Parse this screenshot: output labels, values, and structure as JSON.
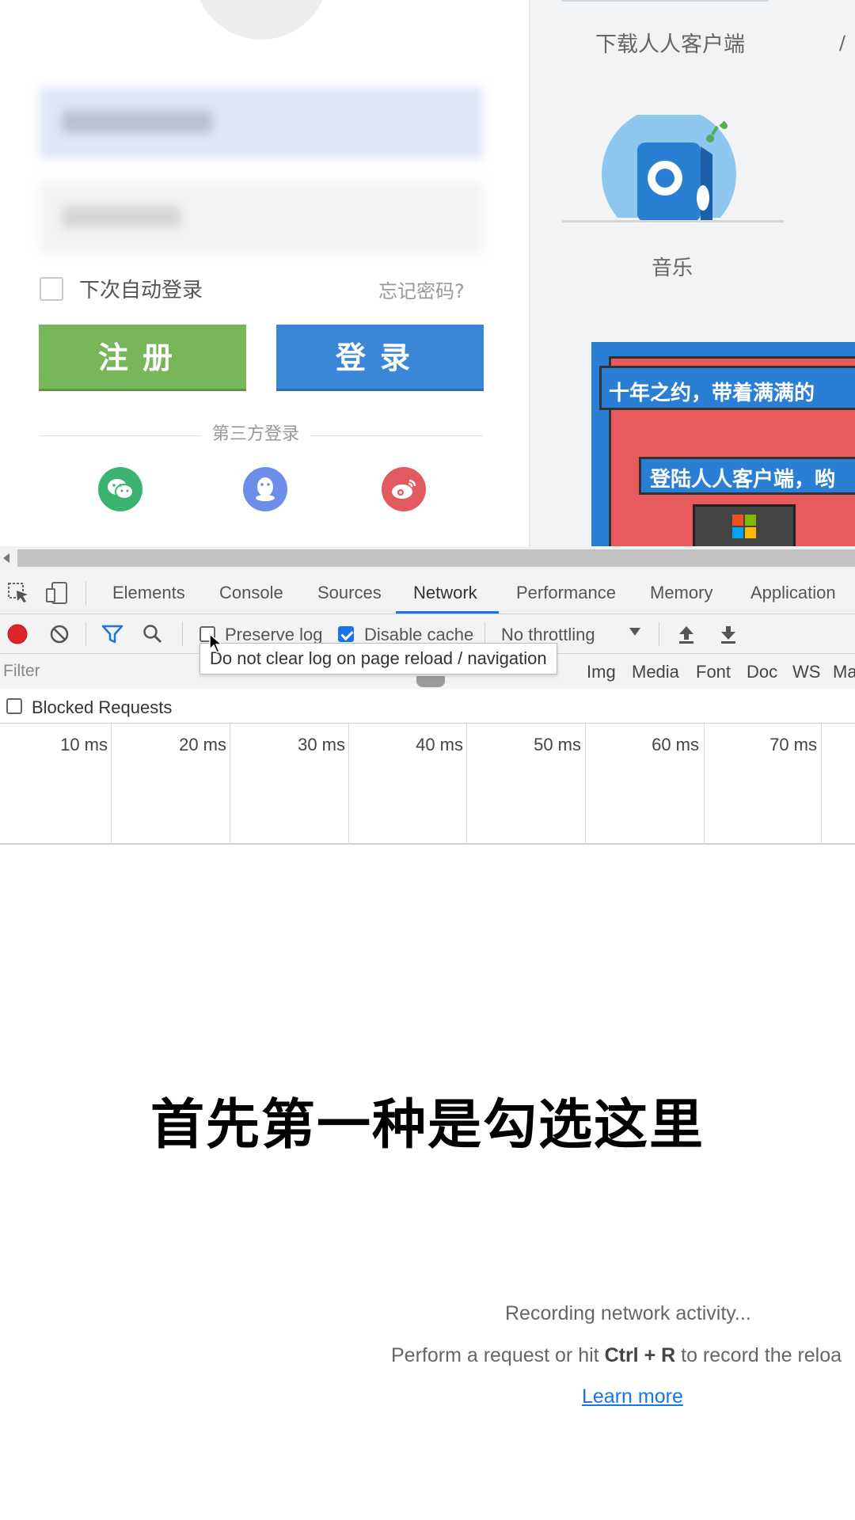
{
  "login": {
    "remember_label": "下次自动登录",
    "forgot_label": "忘记密码?",
    "register_label": "注册",
    "login_label": "登录",
    "third_party_label": "第三方登录",
    "social_icons": [
      "wechat-icon",
      "qq-icon",
      "weibo-icon"
    ]
  },
  "side": {
    "download_label": "下载人人客户端",
    "download_more": "/",
    "music_label": "音乐",
    "banner_line1": "十年之约，带着满满的",
    "banner_line2": "登陆人人客户端，哟"
  },
  "devtools": {
    "tabs": [
      "Elements",
      "Console",
      "Sources",
      "Network",
      "Performance",
      "Memory",
      "Application"
    ],
    "active_tab": "Network",
    "toolbar": {
      "preserve_log": "Preserve log",
      "preserve_log_checked": false,
      "disable_cache": "Disable cache",
      "disable_cache_checked": true,
      "throttling": "No throttling"
    },
    "filter_placeholder": "Filter",
    "type_filters": [
      "Img",
      "Media",
      "Font",
      "Doc",
      "WS",
      "Ma"
    ],
    "tooltip": "Do not clear log on page reload / navigation",
    "blocked_requests": "Blocked Requests",
    "timeline_ticks": [
      "10 ms",
      "20 ms",
      "30 ms",
      "40 ms",
      "50 ms",
      "60 ms",
      "70 ms"
    ],
    "empty": {
      "title": "Recording network activity...",
      "line_prefix": "Perform a request or hit",
      "line_keys": "Ctrl + R",
      "line_suffix": "to record the reloa",
      "learn_more": "Learn more"
    }
  },
  "caption": "首先第一种是勾选这里",
  "colors": {
    "register": "#78b65a",
    "login": "#3c86d8",
    "accent": "#1a73e8",
    "record": "#e0252a"
  }
}
